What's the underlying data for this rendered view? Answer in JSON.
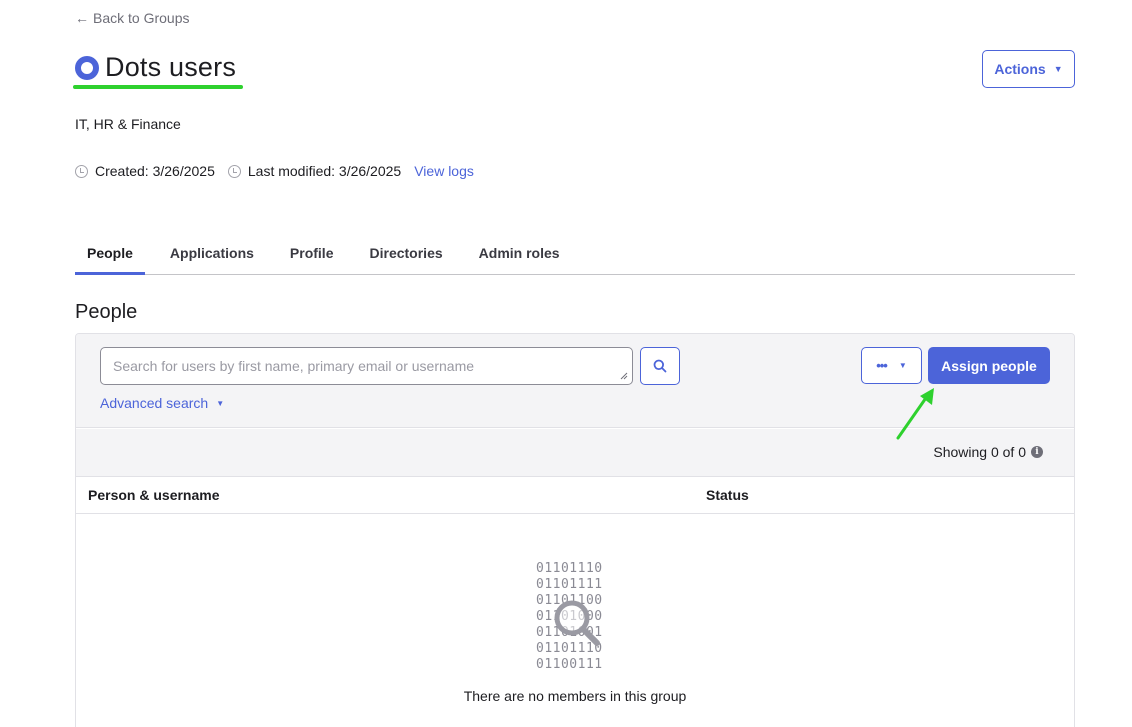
{
  "nav": {
    "back_label": "Back to Groups"
  },
  "group": {
    "title": "Dots users",
    "description": "IT, HR & Finance",
    "created": "Created: 3/26/2025",
    "modified": "Last modified: 3/26/2025",
    "view_logs": "View logs",
    "actions_label": "Actions"
  },
  "tabs": [
    {
      "label": "People",
      "active": true
    },
    {
      "label": "Applications",
      "active": false
    },
    {
      "label": "Profile",
      "active": false
    },
    {
      "label": "Directories",
      "active": false
    },
    {
      "label": "Admin roles",
      "active": false
    }
  ],
  "people": {
    "section_title": "People",
    "search_placeholder": "Search for users by first name, primary email or username",
    "search_value": "",
    "advanced_search": "Advanced search",
    "more_label": "•••",
    "assign_label": "Assign people",
    "showing": "Showing 0 of 0",
    "columns": [
      "Person & username",
      "Status"
    ],
    "empty_binary": [
      "01101110",
      "01101111",
      "01101100",
      "01101000",
      "01101001",
      "01101110",
      "01100111"
    ],
    "empty_message": "There are no members in this group"
  },
  "colors": {
    "accent": "#4c64d9",
    "annotation": "#2ed12e",
    "panel_bg": "#f4f4f6"
  },
  "icons": [
    "back-arrow-icon",
    "group-ring-icon",
    "chevron-down-icon",
    "clock-icon",
    "search-icon",
    "info-icon",
    "magnifier-icon",
    "annotation-arrow-icon"
  ]
}
